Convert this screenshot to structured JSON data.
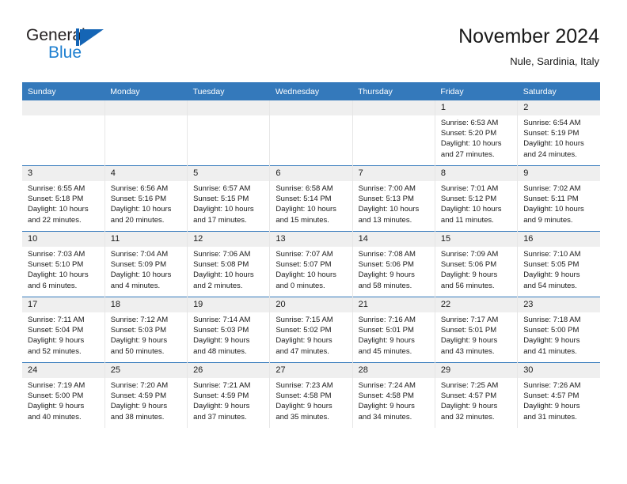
{
  "brand": {
    "name_top": "General",
    "name_bottom": "Blue",
    "logo_icon": "general-blue-triangle-logo",
    "accent_color": "#1d7fd0"
  },
  "header": {
    "title": "November 2024",
    "subtitle": "Nule, Sardinia, Italy"
  },
  "theme": {
    "header_bg": "#3479bb",
    "daynum_bg": "#efefef",
    "row_divider": "#3479bb",
    "text": "#1a1a1a"
  },
  "calendar": {
    "weekday_headers": [
      "Sunday",
      "Monday",
      "Tuesday",
      "Wednesday",
      "Thursday",
      "Friday",
      "Saturday"
    ],
    "weeks": [
      [
        {
          "day": "",
          "sunrise": "",
          "sunset": "",
          "daylight1": "",
          "daylight2": ""
        },
        {
          "day": "",
          "sunrise": "",
          "sunset": "",
          "daylight1": "",
          "daylight2": ""
        },
        {
          "day": "",
          "sunrise": "",
          "sunset": "",
          "daylight1": "",
          "daylight2": ""
        },
        {
          "day": "",
          "sunrise": "",
          "sunset": "",
          "daylight1": "",
          "daylight2": ""
        },
        {
          "day": "",
          "sunrise": "",
          "sunset": "",
          "daylight1": "",
          "daylight2": ""
        },
        {
          "day": "1",
          "sunrise": "Sunrise: 6:53 AM",
          "sunset": "Sunset: 5:20 PM",
          "daylight1": "Daylight: 10 hours",
          "daylight2": "and 27 minutes."
        },
        {
          "day": "2",
          "sunrise": "Sunrise: 6:54 AM",
          "sunset": "Sunset: 5:19 PM",
          "daylight1": "Daylight: 10 hours",
          "daylight2": "and 24 minutes."
        }
      ],
      [
        {
          "day": "3",
          "sunrise": "Sunrise: 6:55 AM",
          "sunset": "Sunset: 5:18 PM",
          "daylight1": "Daylight: 10 hours",
          "daylight2": "and 22 minutes."
        },
        {
          "day": "4",
          "sunrise": "Sunrise: 6:56 AM",
          "sunset": "Sunset: 5:16 PM",
          "daylight1": "Daylight: 10 hours",
          "daylight2": "and 20 minutes."
        },
        {
          "day": "5",
          "sunrise": "Sunrise: 6:57 AM",
          "sunset": "Sunset: 5:15 PM",
          "daylight1": "Daylight: 10 hours",
          "daylight2": "and 17 minutes."
        },
        {
          "day": "6",
          "sunrise": "Sunrise: 6:58 AM",
          "sunset": "Sunset: 5:14 PM",
          "daylight1": "Daylight: 10 hours",
          "daylight2": "and 15 minutes."
        },
        {
          "day": "7",
          "sunrise": "Sunrise: 7:00 AM",
          "sunset": "Sunset: 5:13 PM",
          "daylight1": "Daylight: 10 hours",
          "daylight2": "and 13 minutes."
        },
        {
          "day": "8",
          "sunrise": "Sunrise: 7:01 AM",
          "sunset": "Sunset: 5:12 PM",
          "daylight1": "Daylight: 10 hours",
          "daylight2": "and 11 minutes."
        },
        {
          "day": "9",
          "sunrise": "Sunrise: 7:02 AM",
          "sunset": "Sunset: 5:11 PM",
          "daylight1": "Daylight: 10 hours",
          "daylight2": "and 9 minutes."
        }
      ],
      [
        {
          "day": "10",
          "sunrise": "Sunrise: 7:03 AM",
          "sunset": "Sunset: 5:10 PM",
          "daylight1": "Daylight: 10 hours",
          "daylight2": "and 6 minutes."
        },
        {
          "day": "11",
          "sunrise": "Sunrise: 7:04 AM",
          "sunset": "Sunset: 5:09 PM",
          "daylight1": "Daylight: 10 hours",
          "daylight2": "and 4 minutes."
        },
        {
          "day": "12",
          "sunrise": "Sunrise: 7:06 AM",
          "sunset": "Sunset: 5:08 PM",
          "daylight1": "Daylight: 10 hours",
          "daylight2": "and 2 minutes."
        },
        {
          "day": "13",
          "sunrise": "Sunrise: 7:07 AM",
          "sunset": "Sunset: 5:07 PM",
          "daylight1": "Daylight: 10 hours",
          "daylight2": "and 0 minutes."
        },
        {
          "day": "14",
          "sunrise": "Sunrise: 7:08 AM",
          "sunset": "Sunset: 5:06 PM",
          "daylight1": "Daylight: 9 hours",
          "daylight2": "and 58 minutes."
        },
        {
          "day": "15",
          "sunrise": "Sunrise: 7:09 AM",
          "sunset": "Sunset: 5:06 PM",
          "daylight1": "Daylight: 9 hours",
          "daylight2": "and 56 minutes."
        },
        {
          "day": "16",
          "sunrise": "Sunrise: 7:10 AM",
          "sunset": "Sunset: 5:05 PM",
          "daylight1": "Daylight: 9 hours",
          "daylight2": "and 54 minutes."
        }
      ],
      [
        {
          "day": "17",
          "sunrise": "Sunrise: 7:11 AM",
          "sunset": "Sunset: 5:04 PM",
          "daylight1": "Daylight: 9 hours",
          "daylight2": "and 52 minutes."
        },
        {
          "day": "18",
          "sunrise": "Sunrise: 7:12 AM",
          "sunset": "Sunset: 5:03 PM",
          "daylight1": "Daylight: 9 hours",
          "daylight2": "and 50 minutes."
        },
        {
          "day": "19",
          "sunrise": "Sunrise: 7:14 AM",
          "sunset": "Sunset: 5:03 PM",
          "daylight1": "Daylight: 9 hours",
          "daylight2": "and 48 minutes."
        },
        {
          "day": "20",
          "sunrise": "Sunrise: 7:15 AM",
          "sunset": "Sunset: 5:02 PM",
          "daylight1": "Daylight: 9 hours",
          "daylight2": "and 47 minutes."
        },
        {
          "day": "21",
          "sunrise": "Sunrise: 7:16 AM",
          "sunset": "Sunset: 5:01 PM",
          "daylight1": "Daylight: 9 hours",
          "daylight2": "and 45 minutes."
        },
        {
          "day": "22",
          "sunrise": "Sunrise: 7:17 AM",
          "sunset": "Sunset: 5:01 PM",
          "daylight1": "Daylight: 9 hours",
          "daylight2": "and 43 minutes."
        },
        {
          "day": "23",
          "sunrise": "Sunrise: 7:18 AM",
          "sunset": "Sunset: 5:00 PM",
          "daylight1": "Daylight: 9 hours",
          "daylight2": "and 41 minutes."
        }
      ],
      [
        {
          "day": "24",
          "sunrise": "Sunrise: 7:19 AM",
          "sunset": "Sunset: 5:00 PM",
          "daylight1": "Daylight: 9 hours",
          "daylight2": "and 40 minutes."
        },
        {
          "day": "25",
          "sunrise": "Sunrise: 7:20 AM",
          "sunset": "Sunset: 4:59 PM",
          "daylight1": "Daylight: 9 hours",
          "daylight2": "and 38 minutes."
        },
        {
          "day": "26",
          "sunrise": "Sunrise: 7:21 AM",
          "sunset": "Sunset: 4:59 PM",
          "daylight1": "Daylight: 9 hours",
          "daylight2": "and 37 minutes."
        },
        {
          "day": "27",
          "sunrise": "Sunrise: 7:23 AM",
          "sunset": "Sunset: 4:58 PM",
          "daylight1": "Daylight: 9 hours",
          "daylight2": "and 35 minutes."
        },
        {
          "day": "28",
          "sunrise": "Sunrise: 7:24 AM",
          "sunset": "Sunset: 4:58 PM",
          "daylight1": "Daylight: 9 hours",
          "daylight2": "and 34 minutes."
        },
        {
          "day": "29",
          "sunrise": "Sunrise: 7:25 AM",
          "sunset": "Sunset: 4:57 PM",
          "daylight1": "Daylight: 9 hours",
          "daylight2": "and 32 minutes."
        },
        {
          "day": "30",
          "sunrise": "Sunrise: 7:26 AM",
          "sunset": "Sunset: 4:57 PM",
          "daylight1": "Daylight: 9 hours",
          "daylight2": "and 31 minutes."
        }
      ]
    ]
  }
}
